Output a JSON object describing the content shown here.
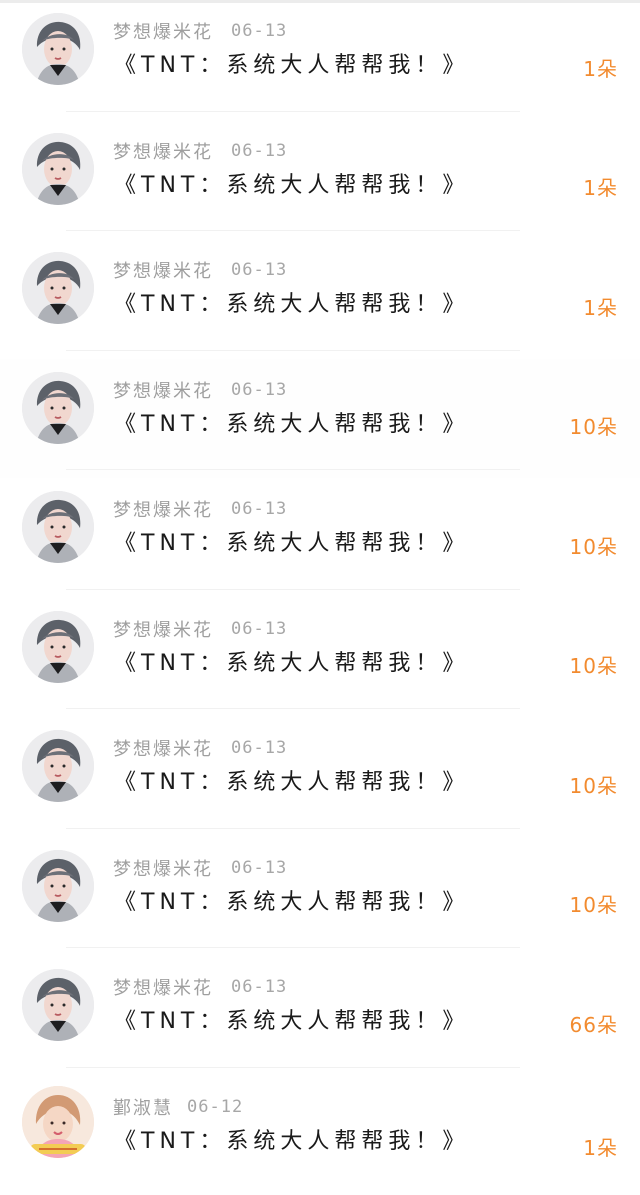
{
  "records": [
    {
      "name": "梦想爆米花",
      "date": "06-13",
      "title": "《TNT：系统大人帮帮我！》",
      "amount": "1朵",
      "avatar": "boy-avatar"
    },
    {
      "name": "梦想爆米花",
      "date": "06-13",
      "title": "《TNT：系统大人帮帮我！》",
      "amount": "1朵",
      "avatar": "boy-avatar"
    },
    {
      "name": "梦想爆米花",
      "date": "06-13",
      "title": "《TNT：系统大人帮帮我！》",
      "amount": "1朵",
      "avatar": "boy-avatar"
    },
    {
      "name": "梦想爆米花",
      "date": "06-13",
      "title": "《TNT：系统大人帮帮我！》",
      "amount": "10朵",
      "avatar": "boy-avatar"
    },
    {
      "name": "梦想爆米花",
      "date": "06-13",
      "title": "《TNT：系统大人帮帮我！》",
      "amount": "10朵",
      "avatar": "boy-avatar"
    },
    {
      "name": "梦想爆米花",
      "date": "06-13",
      "title": "《TNT：系统大人帮帮我！》",
      "amount": "10朵",
      "avatar": "boy-avatar"
    },
    {
      "name": "梦想爆米花",
      "date": "06-13",
      "title": "《TNT：系统大人帮帮我！》",
      "amount": "10朵",
      "avatar": "boy-avatar"
    },
    {
      "name": "梦想爆米花",
      "date": "06-13",
      "title": "《TNT：系统大人帮帮我！》",
      "amount": "10朵",
      "avatar": "boy-avatar"
    },
    {
      "name": "梦想爆米花",
      "date": "06-13",
      "title": "《TNT：系统大人帮帮我！》",
      "amount": "66朵",
      "avatar": "boy-avatar"
    },
    {
      "name": "鄞淑慧",
      "date": "06-12",
      "title": "《TNT：系统大人帮帮我！》",
      "amount": "1朵",
      "avatar": "girl-avatar"
    }
  ],
  "colors": {
    "accent": "#f28b2f",
    "meta_text": "#9f9f9f",
    "title_text": "#1a1a1a"
  }
}
